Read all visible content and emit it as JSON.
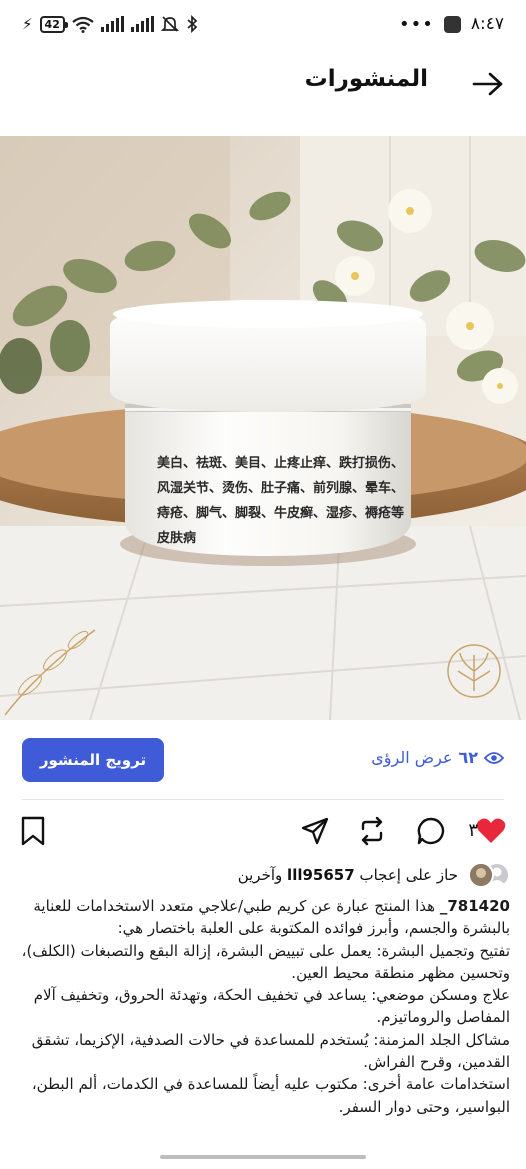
{
  "status_bar": {
    "time": "٨:٤٧",
    "battery": "42"
  },
  "header": {
    "title": "المنشورات"
  },
  "post": {
    "image_label_lines": [
      "美白、祛斑、美目、止疼止痒、跌打损伤、",
      "风湿关节、烫伤、肚子痛、前列腺、晕车、",
      "痔疮、脚气、脚裂、牛皮癣、湿疹、褥疮等皮肤病"
    ],
    "promote_label": "ترويج المنشور",
    "views_count": "٦٢",
    "views_label": "عرض الرؤى",
    "likes_count": "٣",
    "liked_by": {
      "prefix": "حاز على إعجاب",
      "user": "lll95657",
      "suffix": "وآخرين"
    },
    "caption": {
      "username": "781420_",
      "lines": [
        "هذا المنتج عبارة عن كريم طبي/علاجي متعدد الاستخدامات للعناية بالبشرة والجسم، وأبرز فوائده المكتوبة على العلبة باختصار هي:",
        "تفتيح وتجميل البشرة: يعمل على تبييض البشرة، إزالة البقع والتصبغات (الكلف)، وتحسين مظهر منطقة محيط العين.",
        "علاج ومسكن موضعي: يساعد في تخفيف الحكة، وتهدئة الحروق، وتخفيف آلام المفاصل والروماتيزم.",
        "مشاكل الجلد المزمنة: يُستخدم للمساعدة في حالات الصدفية، الإكزيما، تشقق القدمين، وقرح الفراش.",
        "استخدامات عامة أخرى: مكتوب عليه أيضاً للمساعدة في الكدمات، ألم البطن، البواسير، وحتى دوار السفر."
      ]
    }
  },
  "colors": {
    "accent": "#3f5bd8",
    "like": "#e8283a"
  },
  "icons": [
    "charging-bolt-icon",
    "battery-icon",
    "wifi-icon",
    "signal-icon",
    "mute-icon",
    "bluetooth-icon",
    "more-dots-icon",
    "app-icon",
    "back-arrow-icon",
    "eye-icon",
    "heart-icon",
    "comment-icon",
    "repost-icon",
    "share-icon",
    "bookmark-icon"
  ]
}
